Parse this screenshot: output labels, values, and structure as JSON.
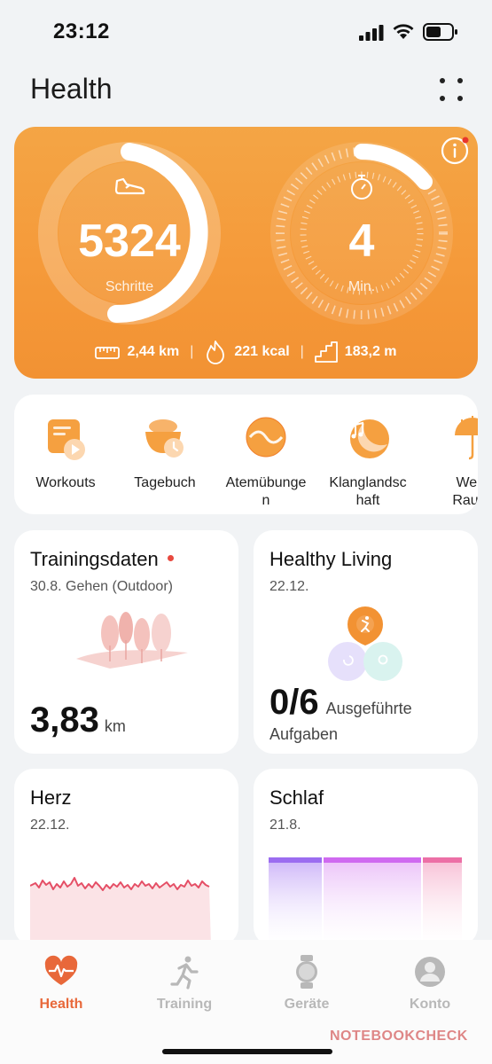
{
  "status_bar": {
    "time": "23:12"
  },
  "header": {
    "title": "Health"
  },
  "activity": {
    "steps_value": "5324",
    "steps_label": "Schritte",
    "minutes_value": "4",
    "minutes_label": "Min.",
    "distance": "2,44 km",
    "calories": "221 kcal",
    "climb": "183,2 m",
    "separator": "|"
  },
  "shortcuts": [
    {
      "label": "Workouts",
      "icon": "workouts-icon"
    },
    {
      "label": "Tagebuch",
      "icon": "diary-icon"
    },
    {
      "label": "Atemübunge n",
      "icon": "breathing-icon"
    },
    {
      "label": "Klanglandsc haft",
      "icon": "soundscape-icon"
    },
    {
      "label": "Weiß Rausc",
      "icon": "white-noise-icon"
    }
  ],
  "cards": {
    "training": {
      "title": "Trainingsdaten",
      "subtitle": "30.8. Gehen (Outdoor)",
      "value": "3,83",
      "unit": "km"
    },
    "healthy": {
      "title": "Healthy Living",
      "subtitle": "22.12.",
      "value": "0/6",
      "unit_line1": "Ausgeführte",
      "unit_line2": "Aufgaben"
    },
    "heart": {
      "title": "Herz",
      "subtitle": "22.12."
    },
    "sleep": {
      "title": "Schlaf",
      "subtitle": "21.8."
    }
  },
  "tabs": [
    {
      "label": "Health",
      "active": true
    },
    {
      "label": "Training",
      "active": false
    },
    {
      "label": "Geräte",
      "active": false
    },
    {
      "label": "Konto",
      "active": false
    }
  ],
  "watermark": "NOTEBOOKCHECK",
  "colors": {
    "accent": "#e8683a",
    "activity_bg": "#f59a3a",
    "red_dot": "#e8493f"
  }
}
